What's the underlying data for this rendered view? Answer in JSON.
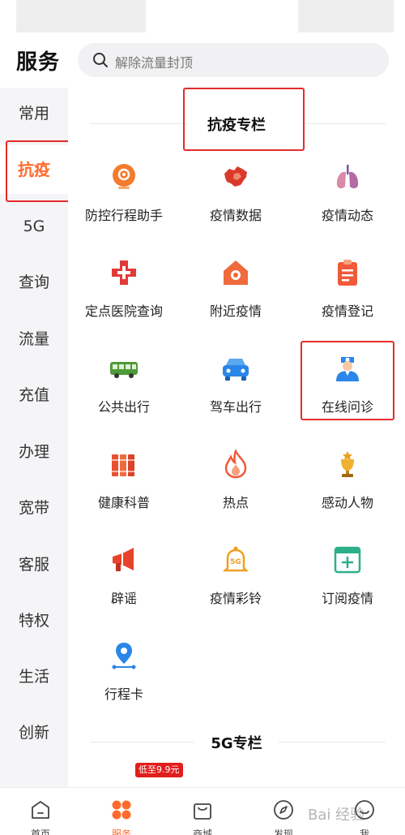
{
  "header": {
    "title": "服务",
    "search_placeholder": "解除流量封顶"
  },
  "sidebar": {
    "items": [
      {
        "label": "常用"
      },
      {
        "label": "抗疫"
      },
      {
        "label": "5G"
      },
      {
        "label": "查询"
      },
      {
        "label": "流量"
      },
      {
        "label": "充值"
      },
      {
        "label": "办理"
      },
      {
        "label": "宽带"
      },
      {
        "label": "客服"
      },
      {
        "label": "特权"
      },
      {
        "label": "生活"
      },
      {
        "label": "创新"
      }
    ],
    "active_index": 1
  },
  "sections": [
    {
      "title": "抗疫专栏",
      "items": [
        {
          "label": "防控行程助手",
          "icon": "location-pin-icon"
        },
        {
          "label": "疫情数据",
          "icon": "china-map-icon"
        },
        {
          "label": "疫情动态",
          "icon": "lungs-icon"
        },
        {
          "label": "定点医院查询",
          "icon": "medical-cross-icon"
        },
        {
          "label": "附近疫情",
          "icon": "house-icon"
        },
        {
          "label": "疫情登记",
          "icon": "clipboard-icon"
        },
        {
          "label": "公共出行",
          "icon": "bus-icon"
        },
        {
          "label": "驾车出行",
          "icon": "car-icon"
        },
        {
          "label": "在线问诊",
          "icon": "doctor-icon"
        },
        {
          "label": "健康科普",
          "icon": "books-icon"
        },
        {
          "label": "热点",
          "icon": "flame-icon"
        },
        {
          "label": "感动人物",
          "icon": "trophy-icon"
        },
        {
          "label": "辟谣",
          "icon": "megaphone-icon"
        },
        {
          "label": "疫情彩铃",
          "icon": "bell-5g-icon"
        },
        {
          "label": "订阅疫情",
          "icon": "subscribe-icon"
        },
        {
          "label": "行程卡",
          "icon": "route-icon"
        }
      ]
    },
    {
      "title": "5G专栏",
      "promo_tag": "低至9.9元"
    }
  ],
  "tabbar": {
    "items": [
      {
        "label": "首页",
        "icon": "home-icon"
      },
      {
        "label": "服务",
        "icon": "service-grid-icon"
      },
      {
        "label": "商城",
        "icon": "shopping-bag-icon"
      },
      {
        "label": "发现",
        "icon": "compass-icon"
      },
      {
        "label": "我",
        "icon": "profile-icon"
      }
    ],
    "active_index": 1
  },
  "watermark": "Bai 经验",
  "colors": {
    "accent": "#ff6a2f",
    "highlight_box": "#e52b2b",
    "sidebar_bg": "#f5f5f7"
  }
}
